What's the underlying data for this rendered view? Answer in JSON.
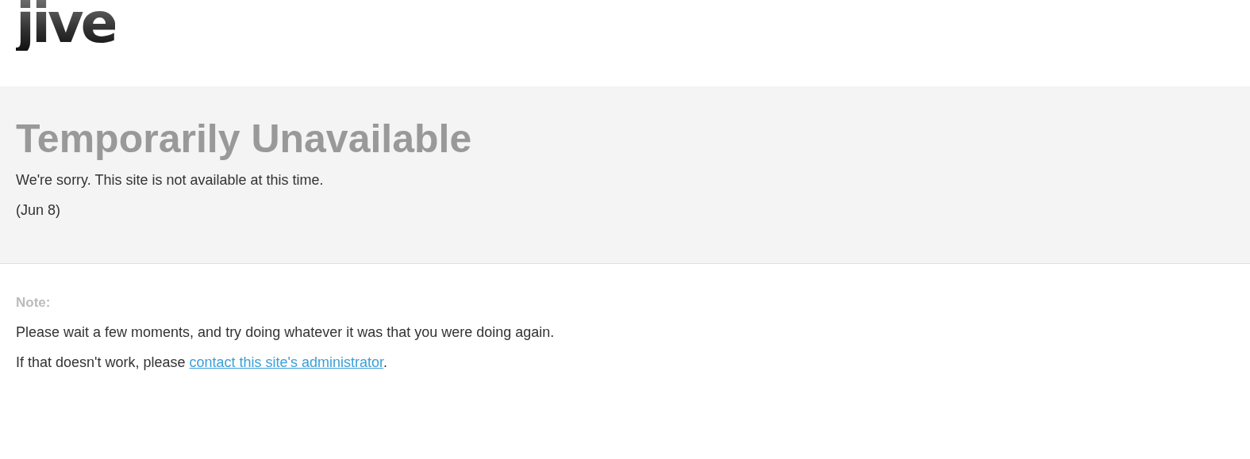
{
  "header": {
    "logo": "jive"
  },
  "notice": {
    "title": "Temporarily Unavailable",
    "message": "We're sorry. This site is not available at this time.",
    "date": "(Jun 8)"
  },
  "note": {
    "label": "Note:",
    "advice": "Please wait a few moments, and try doing whatever it was that you were doing again.",
    "fallback": {
      "before": "If that doesn't work, please ",
      "link": "contact this site's administrator",
      "after": "."
    }
  }
}
